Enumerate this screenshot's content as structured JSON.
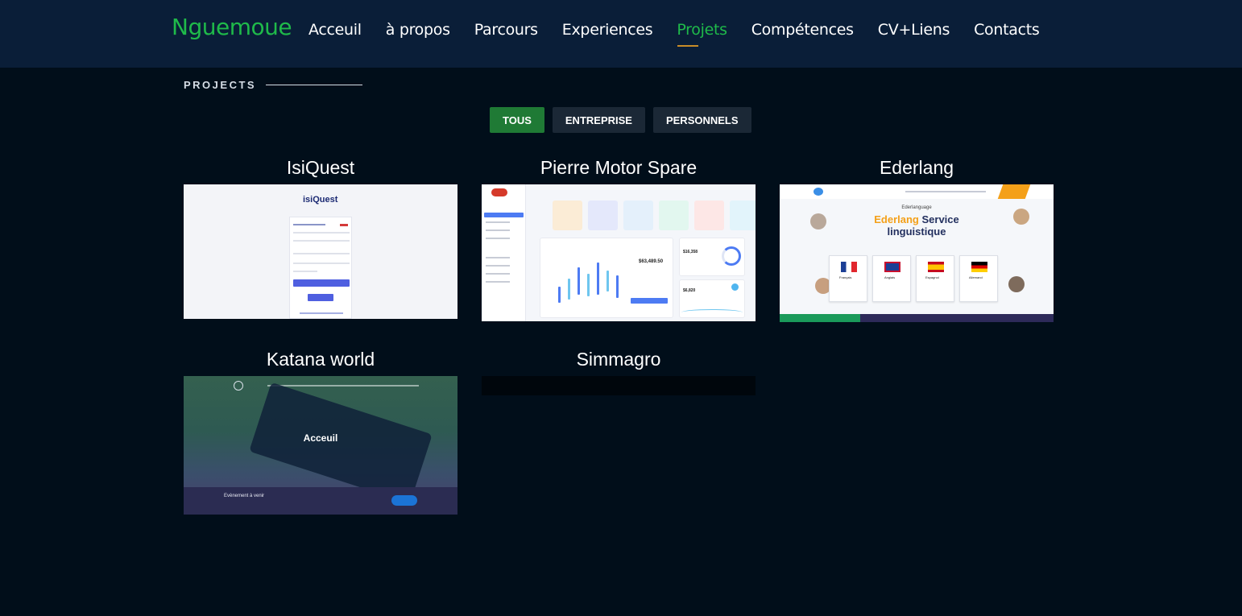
{
  "header": {
    "logo": "Nguemoue",
    "nav": [
      "Acceuil",
      "à propos",
      "Parcours",
      "Experiences",
      "Projets",
      "Compétences",
      "CV+Liens",
      "Contacts"
    ],
    "active_nav": "Projets"
  },
  "section": {
    "title": "PROJECTS"
  },
  "filters": [
    "TOUS",
    "ENTREPRISE",
    "PERSONNELS"
  ],
  "projects": [
    {
      "title": "IsiQuest",
      "thumb_brand": "isiQuest"
    },
    {
      "title": "Pierre Motor Spare",
      "thumb_stat_1": "$63,489.50",
      "thumb_stat_2": "$16,358",
      "thumb_stat_3": "$6,820"
    },
    {
      "title": "Ederlang",
      "thumb_kicker": "Ederlanguage",
      "thumb_head_1": "Ederlang",
      "thumb_head_2": "Service",
      "thumb_head_3": "linguistique",
      "thumb_langs": [
        "Français",
        "Anglais",
        "Espagnol",
        "Allemand"
      ]
    },
    {
      "title": "Katana world",
      "thumb_heading": "Acceuil",
      "thumb_footer": "Evènement à venir"
    },
    {
      "title": "Simmagro"
    }
  ],
  "colors": {
    "accent_green": "#1fba4a",
    "header_bg": "#0a1e38",
    "page_bg": "#010e1a",
    "active_filter": "#1f7a35"
  }
}
